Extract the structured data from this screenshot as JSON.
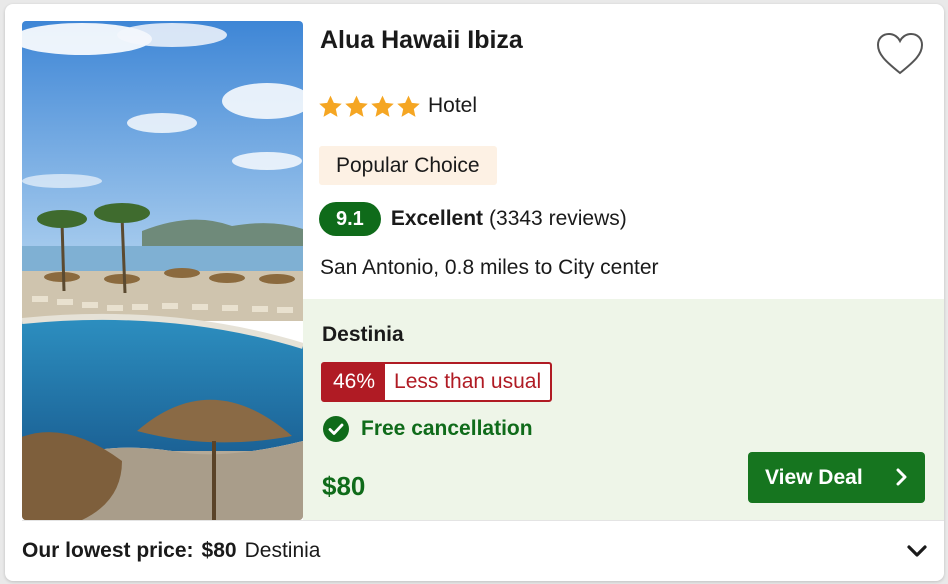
{
  "hotel": {
    "name": "Alua Hawaii Ibiza",
    "star_rating": 4,
    "type": "Hotel",
    "badge": "Popular Choice",
    "score": "9.1",
    "rating_word": "Excellent",
    "reviews": "(3343 reviews)",
    "location": "San Antonio, 0.8 miles to City center",
    "photo": "hotel-pool-beach-photo"
  },
  "deal": {
    "provider": "Destinia",
    "discount_pct": "46%",
    "discount_label": "Less than usual",
    "free_cancellation": "Free cancellation",
    "price": "$80",
    "button_label": "View Deal"
  },
  "footer": {
    "label": "Our lowest price:",
    "amount": "$80",
    "provider": "Destinia"
  },
  "icons": {
    "favorite": "heart-outline-icon",
    "star": "star-icon",
    "check": "check-circle-icon",
    "chevron_right": "chevron-right-icon",
    "expand": "chevron-down-icon"
  },
  "colors": {
    "brand_green": "#0f6b1a",
    "button_green": "#16751f",
    "discount_red": "#b01b24",
    "star_orange": "#f5a623",
    "deal_bg": "#eef5e8",
    "badge_bg": "#fdf1e4"
  }
}
